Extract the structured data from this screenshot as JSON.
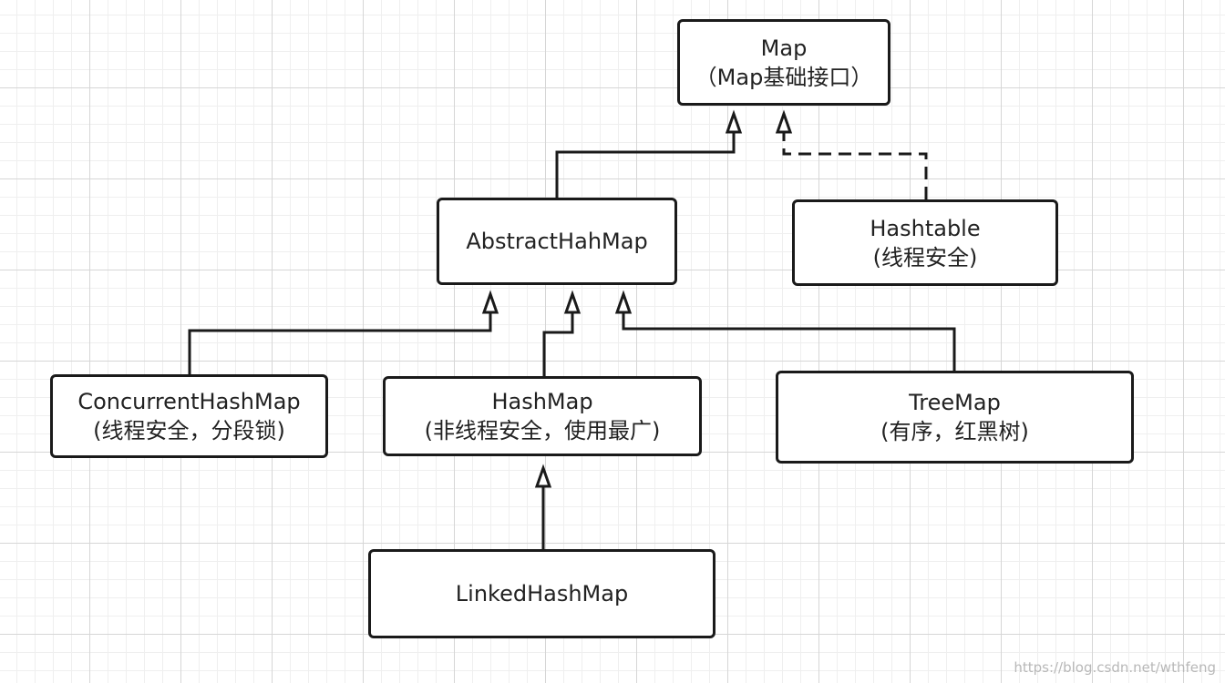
{
  "nodes": {
    "map": {
      "line1": "Map",
      "line2": "（Map基础接口）"
    },
    "abstract": {
      "line1": "AbstractHahMap"
    },
    "hashtable": {
      "line1": "Hashtable",
      "line2": "(线程安全)"
    },
    "concurrent": {
      "line1": "ConcurrentHashMap",
      "line2": "(线程安全，分段锁)"
    },
    "hashmap": {
      "line1": "HashMap",
      "line2": "(非线程安全，使用最广)"
    },
    "treemap": {
      "line1": "TreeMap",
      "line2": "(有序，红黑树)"
    },
    "linked": {
      "line1": "LinkedHashMap"
    }
  },
  "edges": [
    {
      "from": "abstract",
      "to": "map",
      "style": "solid"
    },
    {
      "from": "hashtable",
      "to": "map",
      "style": "dashed"
    },
    {
      "from": "concurrent",
      "to": "abstract",
      "style": "solid"
    },
    {
      "from": "hashmap",
      "to": "abstract",
      "style": "solid"
    },
    {
      "from": "treemap",
      "to": "abstract",
      "style": "solid"
    },
    {
      "from": "linked",
      "to": "hashmap",
      "style": "solid"
    }
  ],
  "colors": {
    "stroke": "#1a1a1a",
    "background": "#ffffff"
  },
  "watermark": "https://blog.csdn.net/wthfeng"
}
